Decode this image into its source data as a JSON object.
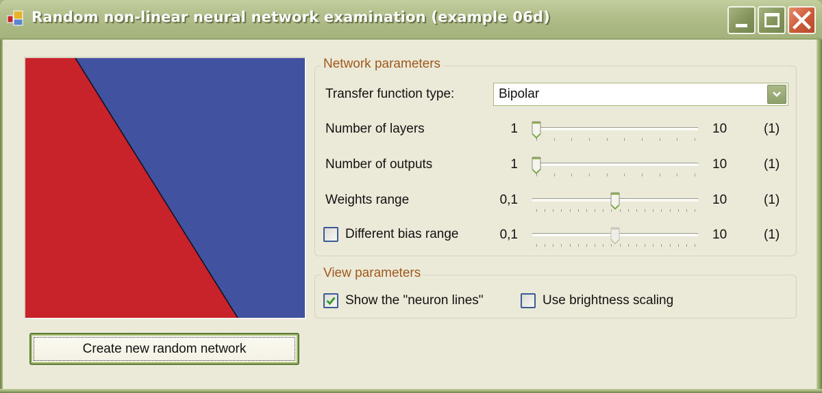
{
  "window": {
    "title": "Random non-linear neural network examination (example 06d)",
    "controls": {
      "minimize": "minimize-icon",
      "maximize": "maximize-icon",
      "close": "close-icon"
    }
  },
  "output_view": {
    "description": "network output map",
    "regions": [
      {
        "name": "negative-output-region",
        "color": "#c8232b"
      },
      {
        "name": "positive-output-region",
        "color": "#4152a0"
      }
    ],
    "boundary_line_color": "#101020"
  },
  "create_button": {
    "label": "Create new random network"
  },
  "network_parameters": {
    "legend": "Network parameters",
    "transfer_function": {
      "label": "Transfer function type:",
      "value": "Bipolar"
    },
    "layers": {
      "label": "Number of layers",
      "min": "1",
      "max": "10",
      "value_display": "(1)",
      "value": 1,
      "range": [
        1,
        10
      ],
      "ticks": 10
    },
    "outputs": {
      "label": "Number of outputs",
      "min": "1",
      "max": "10",
      "value_display": "(1)",
      "value": 1,
      "range": [
        1,
        10
      ],
      "ticks": 10
    },
    "weights_range": {
      "label": "Weights range",
      "min": "0,1",
      "max": "10",
      "value_display": "(1)",
      "position_fraction": 0.5,
      "ticks": 20
    },
    "bias_range": {
      "checkbox_label": "Different bias range",
      "checked": false,
      "enabled": false,
      "min": "0,1",
      "max": "10",
      "value_display": "(1)",
      "position_fraction": 0.5,
      "ticks": 20
    }
  },
  "view_parameters": {
    "legend": "View parameters",
    "show_neuron_lines": {
      "label": "Show the \"neuron lines\"",
      "checked": true
    },
    "brightness_scaling": {
      "label": "Use brightness scaling",
      "checked": false
    }
  },
  "colors": {
    "accent_legend": "#a0591c",
    "titlebar": "#aab783",
    "close_button": "#cb5a37",
    "checkbox_check": "#3c9a2e"
  }
}
